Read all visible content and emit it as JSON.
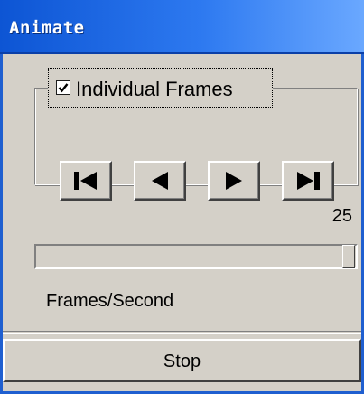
{
  "window": {
    "title": "Animate"
  },
  "frames_group": {
    "checkbox_label": "Individual Frames",
    "checkbox_checked": true,
    "buttons": [
      {
        "name": "first-frame",
        "icon": "skip-to-start-icon"
      },
      {
        "name": "previous-frame",
        "icon": "step-back-icon"
      },
      {
        "name": "next-frame",
        "icon": "step-forward-icon"
      },
      {
        "name": "last-frame",
        "icon": "skip-to-end-icon"
      }
    ]
  },
  "speed": {
    "value": "25",
    "label": "Frames/Second",
    "slider_fraction": 1.0
  },
  "stop_button": {
    "label": "Stop"
  },
  "colors": {
    "titlebar": "#0d55d4",
    "window_bg": "#d4d0c8",
    "title_text": "#ffffff"
  }
}
